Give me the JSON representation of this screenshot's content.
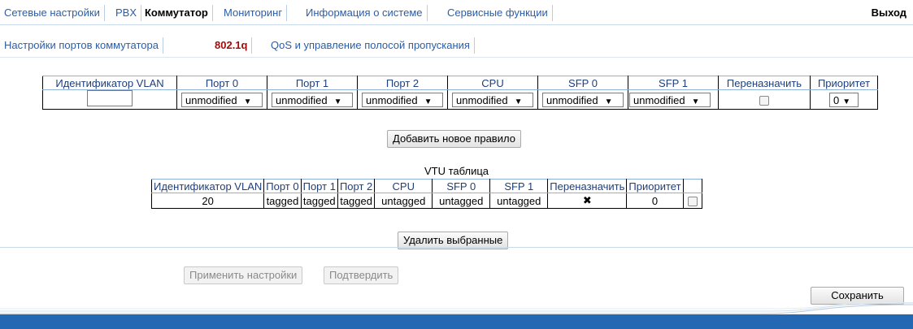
{
  "topnav": {
    "items": [
      "Сетевые настройки",
      "PBX",
      "Коммутатор",
      "Мониторинг",
      "Информация о системе",
      "Сервисные функции"
    ],
    "exit": "Выход"
  },
  "subnav": {
    "items": [
      "Настройки портов коммутатора",
      "802.1q",
      "QoS и управление полосой пропускания"
    ]
  },
  "rule_table": {
    "headers": [
      "Идентификатор VLAN",
      "Порт 0",
      "Порт 1",
      "Порт 2",
      "CPU",
      "SFP 0",
      "SFP 1",
      "Переназначить",
      "Приоритет"
    ],
    "vlan_value": "",
    "selects": [
      "unmodified",
      "unmodified",
      "unmodified",
      "unmodified",
      "unmodified",
      "unmodified"
    ],
    "priority": "0"
  },
  "add_rule_button": "Добавить новое правило",
  "vtu": {
    "title": "VTU таблица",
    "headers": [
      "Идентификатор VLAN",
      "Порт 0",
      "Порт 1",
      "Порт 2",
      "CPU",
      "SFP 0",
      "SFP 1",
      "Переназначить",
      "Приоритет"
    ],
    "rows": [
      {
        "vlan": "20",
        "p0": "tagged",
        "p1": "tagged",
        "p2": "tagged",
        "cpu": "untagged",
        "sfp0": "untagged",
        "sfp1": "untagged",
        "reassign": "✖",
        "priority": "0"
      }
    ]
  },
  "delete_selected_button": "Удалить выбранные",
  "apply_button": "Применить настройки",
  "confirm_button": "Подтвердить",
  "save_button": "Сохранить",
  "colors": {
    "link": "#2a5ea8",
    "active_sub": "#a60b0b",
    "bottom_bar": "#2467b3"
  }
}
